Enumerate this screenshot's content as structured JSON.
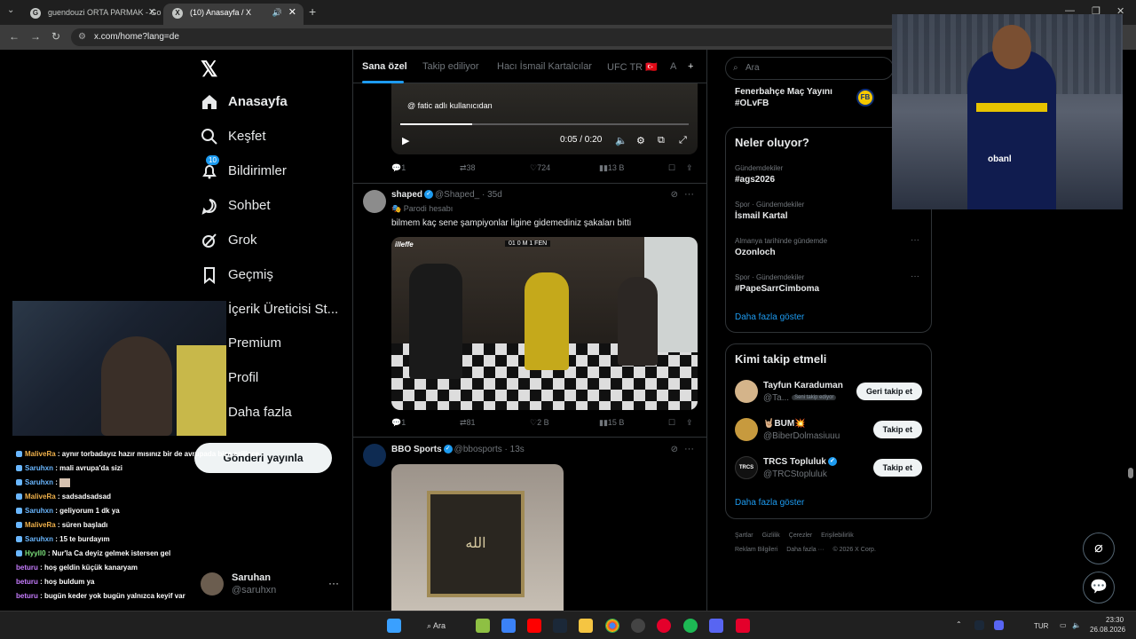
{
  "browser": {
    "tabs": [
      {
        "title": "guendouzi ORTA PARMAK - Go",
        "close": "✕",
        "favicon": "G"
      },
      {
        "title": "(10) Anasayfa / X",
        "close": "✕",
        "favicon": "X"
      }
    ],
    "new_tab": "+",
    "url": "x.com/home?lang=de",
    "window_controls": [
      "—",
      "❐",
      "✕"
    ]
  },
  "x_nav": {
    "logo": "𝕏",
    "items": [
      {
        "label": "Anasayfa",
        "icon": "home-icon"
      },
      {
        "label": "Keşfet",
        "icon": "search-icon"
      },
      {
        "label": "Bildirimler",
        "icon": "bell-icon",
        "badge": "10"
      },
      {
        "label": "Sohbet",
        "icon": "chat-icon"
      },
      {
        "label": "Grok",
        "icon": "grok-icon"
      },
      {
        "label": "Geçmiş",
        "icon": "bookmark-icon"
      },
      {
        "label": "İçerik Üreticisi St...",
        "icon": "creator-icon"
      },
      {
        "label": "Premium",
        "icon": "premium-icon"
      },
      {
        "label": "Profil",
        "icon": "profile-icon"
      },
      {
        "label": "Daha fazla",
        "icon": "more-icon"
      }
    ],
    "post_button": "Gönderi yayınla",
    "account": {
      "name": "Saruhan",
      "handle": "@saruhxn",
      "more": "···"
    }
  },
  "chat": [
    {
      "user": "MaliveRa",
      "text": ": aynır torbadayız hazır mısınız bir de avrupada bize ezilince",
      "color": "#f0b14b"
    },
    {
      "user": "Saruhxn",
      "text": ": mali avrupa'da sizi",
      "color": "#6ab7ff"
    },
    {
      "user": "Saruhxn",
      "text": ":",
      "color": "#6ab7ff"
    },
    {
      "user": "MaliveRa",
      "text": ": sadsadsadsad",
      "color": "#f0b14b"
    },
    {
      "user": "Saruhxn",
      "text": ": geliyorum 1 dk ya",
      "color": "#6ab7ff"
    },
    {
      "user": "MaliveRa",
      "text": ": süren başladı",
      "color": "#f0b14b"
    },
    {
      "user": "Saruhxn",
      "text": ": 15 te burdayım",
      "color": "#6ab7ff"
    },
    {
      "user": "Hyyll0",
      "text": ": Nur'la Ca deyiz gelmek istersen gel",
      "color": "#7be07b"
    },
    {
      "user": "beturu",
      "text": ": hoş geldin küçük kanaryam",
      "color": "#c77dff"
    },
    {
      "user": "beturu",
      "text": ": hoş buldum ya",
      "color": "#c77dff"
    },
    {
      "user": "beturu",
      "text": ": bugün keder yok bugün yalnızca keyif var",
      "color": "#c77dff"
    }
  ],
  "feed": {
    "tabs": [
      "Sana özel",
      "Takip ediliyor",
      "Hacı İsmail Kartalcılar",
      "UFC TR 🇹🇷",
      "A"
    ],
    "add_tab": "+",
    "video1": {
      "caption": "@ fatic adlı kullanıcıdan",
      "time": "0:05 / 0:20",
      "progress": 0.25
    },
    "actions1": {
      "reply": "1",
      "repost": "38",
      "like": "724",
      "views": "13 B"
    },
    "post2": {
      "name": "shaped",
      "handle": "@Shaped_",
      "time": "· 35d",
      "parody": "Parodi hesabı",
      "text": "bilmem kaç sene şampiyonlar ligine gidemediniz şakaları bitti",
      "image_brand": "illeffe",
      "image_score": "01  0 M 1  FEN",
      "reply": "1",
      "repost": "81",
      "like": "2 B",
      "views": "15 B"
    },
    "post3": {
      "name": "BBO Sports",
      "handle": "@bbosports",
      "time": "· 13s",
      "image_text": "الله"
    }
  },
  "right": {
    "search_placeholder": "Ara",
    "live": {
      "title": "Fenerbahçe Maç Yayını",
      "tag": "#OLvFB"
    },
    "trends_title": "Neler oluyor?",
    "trends": [
      {
        "category": "Gündemdekiler",
        "name": "#ags2026"
      },
      {
        "category": "Spor · Gündemdekiler",
        "name": "İsmail Kartal"
      },
      {
        "category": "Almanya tarihinde gündemde",
        "name": "Ozonloch"
      },
      {
        "category": "Spor · Gündemdekiler",
        "name": "#PapeSarrCimboma"
      }
    ],
    "show_more": "Daha fazla göster",
    "follow_title": "Kimi takip etmeli",
    "follow": [
      {
        "name": "Tayfun Karaduman",
        "handle": "@Ta...",
        "pill": "Seni takip ediyor",
        "button": "Geri takip et",
        "avatar_color": "#d4b48a"
      },
      {
        "name": "🤘🏼BUM💥",
        "handle": "@BiberDolmasiuuu",
        "button": "Takip et",
        "avatar_color": "#c79a3e"
      },
      {
        "name": "TRCS Topluluk",
        "handle": "@TRCStopluluk",
        "button": "Takip et",
        "avatar_color": "#111111"
      }
    ],
    "show_more2": "Daha fazla göster",
    "footer1": [
      "Şartlar",
      "Gizlilik",
      "Çerezler",
      "Erişilebilirlik"
    ],
    "footer2": [
      "Reklam Bilgileri",
      "Daha fazla ···",
      "© 2026 X Corp."
    ]
  },
  "pip": {
    "shirt_text": "obanl"
  },
  "taskbar": {
    "search": "Ara",
    "lang": "TUR",
    "time": "23:30",
    "date": "26.08.2026"
  },
  "colors": {
    "accent": "#1d9bf0",
    "background": "#000000",
    "border": "#2f3336"
  }
}
